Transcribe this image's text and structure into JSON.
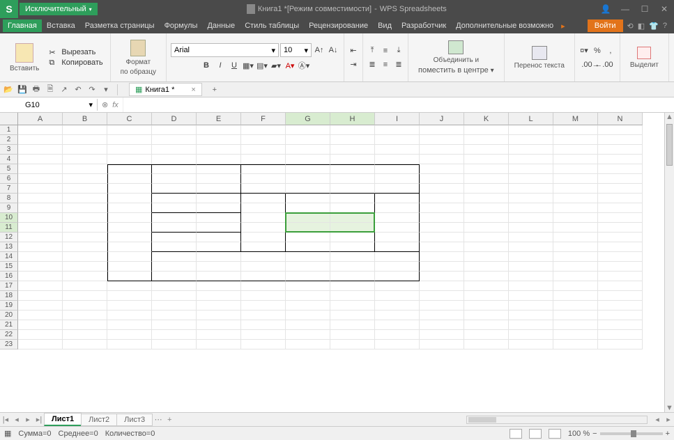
{
  "titlebar": {
    "app_letter": "S",
    "mode_label": "Исключительный",
    "doc_title": "Книга1 *[Режим совместимости]",
    "app_name": "WPS Spreadsheets"
  },
  "menu": {
    "items": [
      "Главная",
      "Вставка",
      "Разметка страницы",
      "Формулы",
      "Данные",
      "Стиль таблицы",
      "Рецензирование",
      "Вид",
      "Разработчик",
      "Дополнительные возможно"
    ],
    "login": "Войти"
  },
  "ribbon": {
    "paste": "Вставить",
    "cut": "Вырезать",
    "copy": "Копировать",
    "format_painter": "Формат",
    "format_painter2": "по образцу",
    "font_name": "Arial",
    "font_size": "10",
    "merge_center1": "Объединить и",
    "merge_center2": "поместить в центре",
    "wrap_text": "Перенос текста",
    "select_all": "Выделит"
  },
  "doc_tab": {
    "label": "Книга1 *"
  },
  "name_box": "G10",
  "columns": [
    "A",
    "B",
    "C",
    "D",
    "E",
    "F",
    "G",
    "H",
    "I",
    "J",
    "K",
    "L",
    "M",
    "N"
  ],
  "rows": [
    "1",
    "2",
    "3",
    "4",
    "5",
    "6",
    "7",
    "8",
    "9",
    "10",
    "11",
    "12",
    "13",
    "14",
    "15",
    "16",
    "17",
    "18",
    "19",
    "20",
    "21",
    "22",
    "23"
  ],
  "sel_cols": [
    "G",
    "H"
  ],
  "sel_rows": [
    "10",
    "11"
  ],
  "sheet_tabs": [
    "Лист1",
    "Лист2",
    "Лист3"
  ],
  "status": {
    "sum": "Сумма=0",
    "avg": "Среднее=0",
    "count": "Количество=0",
    "zoom": "100 %"
  }
}
